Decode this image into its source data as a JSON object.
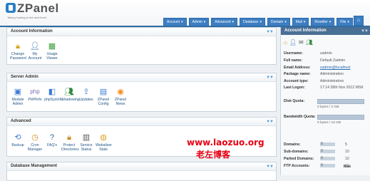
{
  "brand": {
    "name": "ZPanel",
    "tagline": "Taking hosting to the next level."
  },
  "nav": [
    {
      "label": "Account"
    },
    {
      "label": "Admin"
    },
    {
      "label": "Advanced"
    },
    {
      "label": "Database"
    },
    {
      "label": "Domain"
    },
    {
      "label": "Mail"
    },
    {
      "label": "Reseller"
    },
    {
      "label": "File"
    }
  ],
  "panels": {
    "account": {
      "title": "Account Information",
      "items": [
        {
          "label": "Change Password",
          "icon": "lock-icon"
        },
        {
          "label": "My Account",
          "icon": "user-icon"
        },
        {
          "label": "Usage Viewer",
          "icon": "chart-icon"
        }
      ]
    },
    "server": {
      "title": "Server Admin",
      "items": [
        {
          "label": "Module Admin",
          "icon": "modules-icon"
        },
        {
          "label": "PHPInfo",
          "icon": "php-icon"
        },
        {
          "label": "phpSysInfo",
          "icon": "sysinfo-icon"
        },
        {
          "label": "Shadowing",
          "icon": "users-icon"
        },
        {
          "label": "Updates",
          "icon": "arrow-up-icon"
        },
        {
          "label": "ZPanel Config",
          "icon": "config-icon"
        },
        {
          "label": "ZPanel News",
          "icon": "rss-icon"
        }
      ]
    },
    "advanced": {
      "title": "Advanced",
      "items": [
        {
          "label": "Backup",
          "icon": "backup-icon"
        },
        {
          "label": "Cron Manager",
          "icon": "clock-icon"
        },
        {
          "label": "FAQ's",
          "icon": "question-icon"
        },
        {
          "label": "Protect Directories",
          "icon": "lock-folder-icon"
        },
        {
          "label": "Service Status",
          "icon": "server-icon"
        },
        {
          "label": "Webalizer Stats",
          "icon": "globe-icon"
        }
      ]
    },
    "database": {
      "title": "Database Management"
    }
  },
  "sidebar": {
    "title": "Account Information",
    "fields": [
      {
        "k": "Username:",
        "v": "zadmin"
      },
      {
        "k": "Full name:",
        "v": "Default Zadmin"
      },
      {
        "k": "Email Address:",
        "v": "zadmin@localhost"
      },
      {
        "k": "Package name:",
        "v": "Administration"
      },
      {
        "k": "Account type:",
        "v": "Administrators"
      },
      {
        "k": "Last Logon:",
        "v": "17:14 28th Nov 2012 MSK"
      }
    ],
    "disk": {
      "label": "Disk Quota:",
      "text": "0 bytes / 2 GB",
      "bar_pct": "0%",
      "value": 0
    },
    "bandwidth": {
      "label": "Bandwidth Quota:",
      "text": "0 bytes / 10 GB",
      "bar_pct": "0%",
      "value": 0
    },
    "usage_headers": {
      "used": "Used",
      "max": "Max"
    },
    "usage": [
      {
        "label": "Domains:",
        "used": "0",
        "max": "5"
      },
      {
        "label": "Sub-domains:",
        "used": "0",
        "max": "10"
      },
      {
        "label": "Parked Domains:",
        "used": "0",
        "max": "10"
      },
      {
        "label": "FTP Accounts:",
        "used": "0",
        "max": "10"
      }
    ]
  },
  "watermark": {
    "url": "www.laozuo.org",
    "cn": "老左博客"
  }
}
